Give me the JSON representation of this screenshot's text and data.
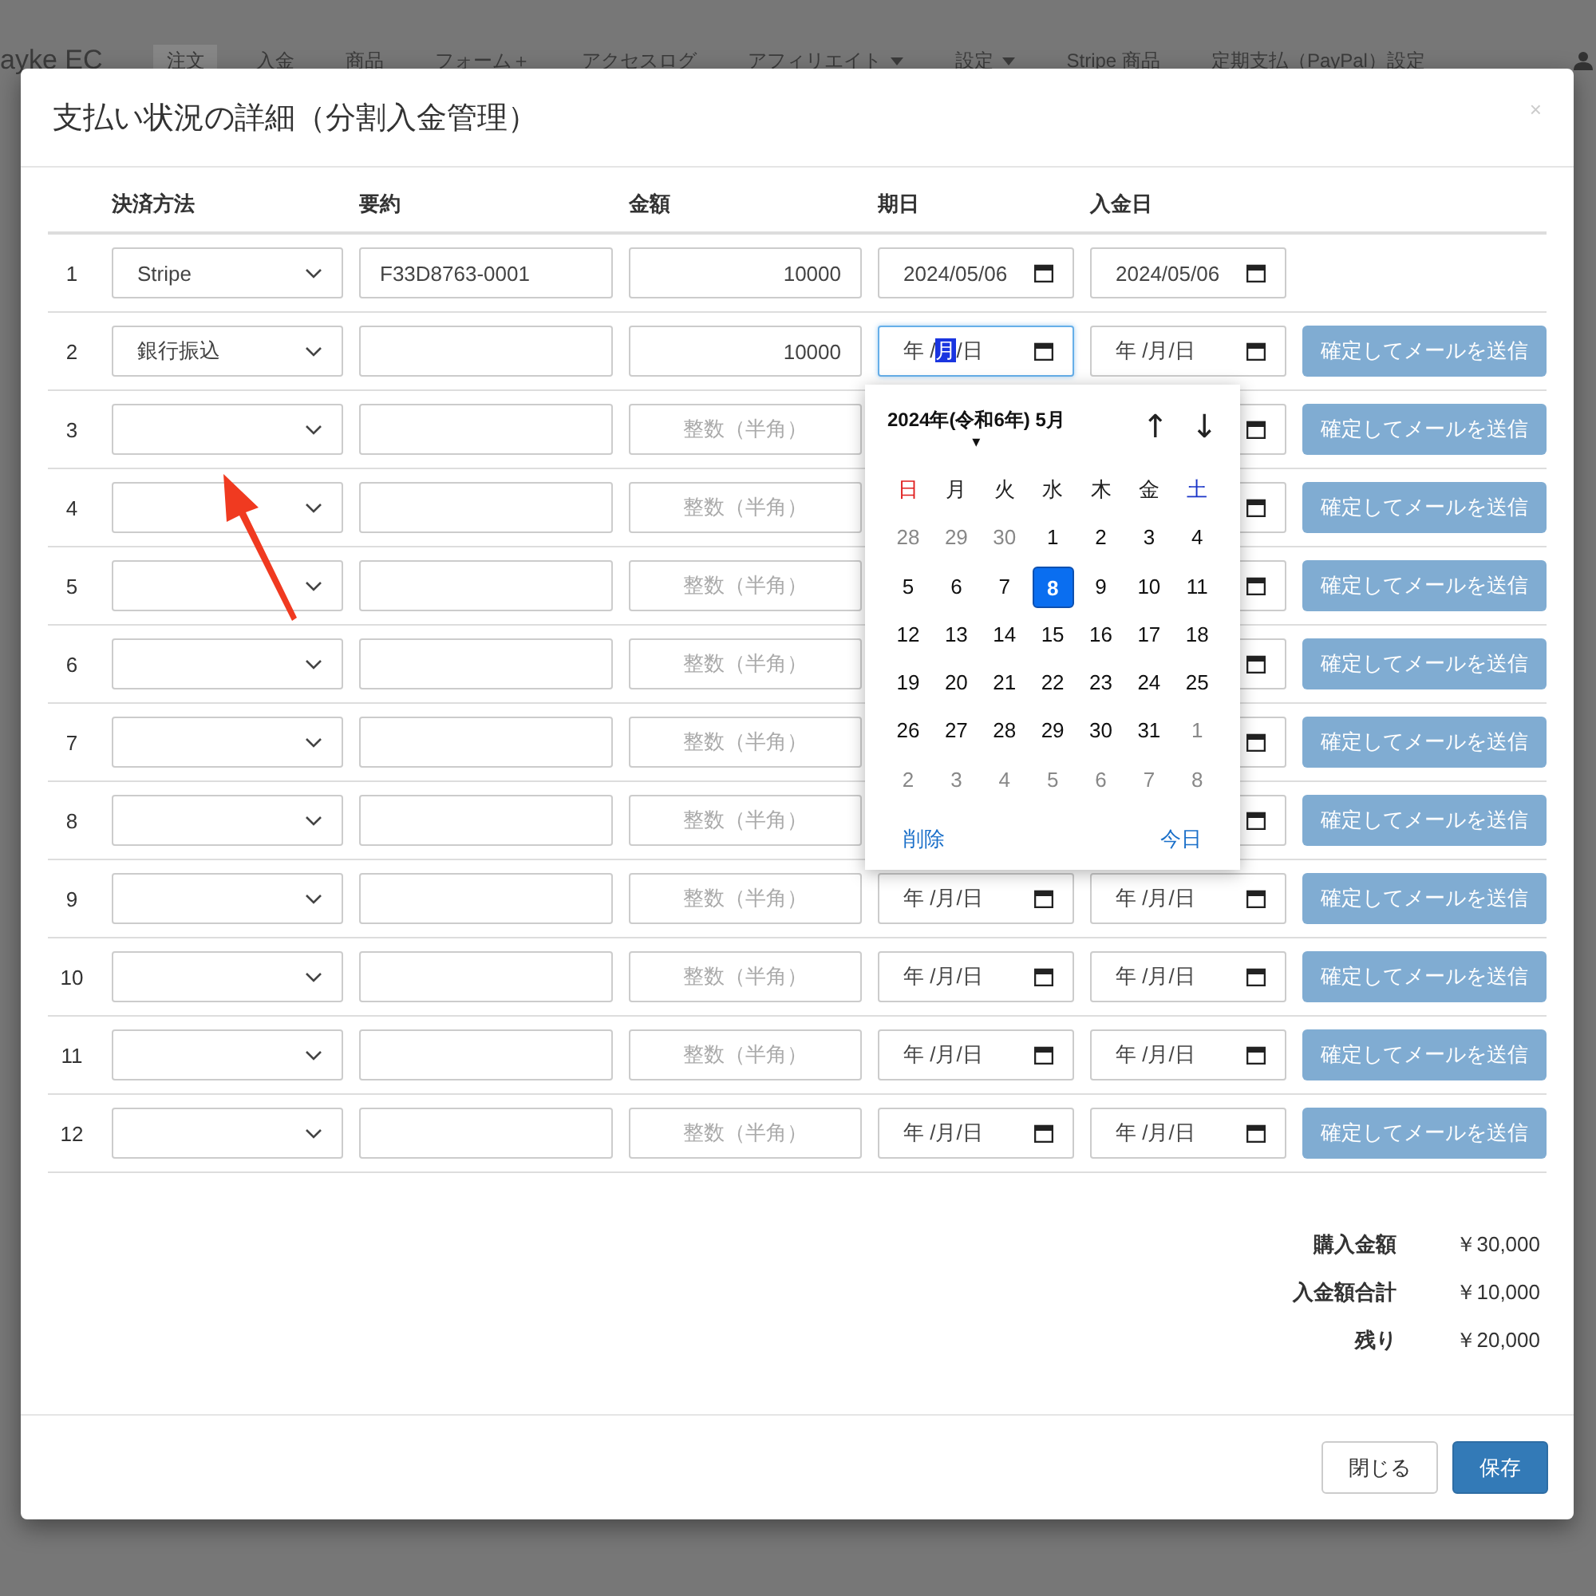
{
  "nav": {
    "brand": "ayke EC",
    "items": [
      {
        "label": "注文",
        "selected": true,
        "dropdown": false
      },
      {
        "label": "入金",
        "selected": false,
        "dropdown": false
      },
      {
        "label": "商品",
        "selected": false,
        "dropdown": false
      },
      {
        "label": "フォーム＋",
        "selected": false,
        "dropdown": false
      },
      {
        "label": "アクセスログ",
        "selected": false,
        "dropdown": false
      },
      {
        "label": "アフィリエイト",
        "selected": false,
        "dropdown": true
      },
      {
        "label": "設定",
        "selected": false,
        "dropdown": true
      },
      {
        "label": "Stripe 商品",
        "selected": false,
        "dropdown": false
      },
      {
        "label": "定期支払（PayPal）設定",
        "selected": false,
        "dropdown": false
      }
    ]
  },
  "modal": {
    "title": "支払い状況の詳細（分割入金管理）",
    "close": "×",
    "columns": [
      "決済方法",
      "要約",
      "金額",
      "期日",
      "入金日"
    ],
    "rows": [
      {
        "number": "1",
        "method": "Stripe",
        "summary": "F33D8763-0001",
        "amount": "10000",
        "due_date": {
          "value": "2024/05/06"
        },
        "paid_date": {
          "value": "2024/05/06"
        }
      },
      {
        "number": "2",
        "method": "銀行振込",
        "amount": "10000",
        "due_date": {
          "focused": true,
          "segments": [
            {
              "text": "年 /",
              "selected": false
            },
            {
              "text": "月",
              "selected": true
            },
            {
              "text": "/日",
              "selected": false
            }
          ]
        },
        "paid_date": {
          "value": "年 /月/日"
        },
        "button": {
          "label": "確定してメールを送信",
          "disabled": true
        }
      },
      {
        "number": "3",
        "placeholder": "整数（半角）",
        "button": {
          "label": "確定してメールを送信",
          "disabled": true
        }
      },
      {
        "number": "4",
        "placeholder": "整数（半角）",
        "button": {
          "label": "確定してメールを送信",
          "disabled": true
        }
      },
      {
        "number": "5",
        "placeholder": "整数（半角）",
        "button": {
          "label": "確定してメールを送信",
          "disabled": true
        }
      },
      {
        "number": "6",
        "placeholder": "整数（半角）",
        "button": {
          "label": "確定してメールを送信",
          "disabled": true
        }
      },
      {
        "number": "7",
        "placeholder": "整数（半角）",
        "button": {
          "label": "確定してメールを送信",
          "disabled": true
        }
      },
      {
        "number": "8",
        "placeholder": "整数（半角）",
        "button": {
          "label": "確定してメールを送信",
          "disabled": true
        }
      },
      {
        "number": "9",
        "placeholder": "整数（半角）",
        "due_date": {
          "value": "年 /月/日"
        },
        "paid_date": {
          "value": "年 /月/日"
        },
        "button": {
          "label": "確定してメールを送信",
          "disabled": true
        }
      },
      {
        "number": "10",
        "placeholder": "整数（半角）",
        "due_date": {
          "value": "年 /月/日"
        },
        "paid_date": {
          "value": "年 /月/日"
        },
        "button": {
          "label": "確定してメールを送信",
          "disabled": true
        }
      },
      {
        "number": "11",
        "placeholder": "整数（半角）",
        "due_date": {
          "value": "年 /月/日"
        },
        "paid_date": {
          "value": "年 /月/日"
        },
        "button": {
          "label": "確定してメールを送信",
          "disabled": true
        }
      },
      {
        "number": "12",
        "placeholder": "整数（半角）",
        "due_date": {
          "value": "年 /月/日"
        },
        "paid_date": {
          "value": "年 /月/日"
        },
        "button": {
          "label": "確定してメールを送信",
          "disabled": true
        }
      }
    ],
    "datepicker": {
      "title": "2024年(令和6年) 5月",
      "caret": "▾",
      "prev": "↑",
      "next": "↓",
      "weekdays": [
        {
          "label": "日",
          "color": "#e01e1e"
        },
        {
          "label": "月",
          "color": "#222222"
        },
        {
          "label": "火",
          "color": "#222222"
        },
        {
          "label": "水",
          "color": "#222222"
        },
        {
          "label": "木",
          "color": "#222222"
        },
        {
          "label": "金",
          "color": "#222222"
        },
        {
          "label": "土",
          "color": "#1a35c8"
        }
      ],
      "weeks": [
        [
          {
            "label": "28",
            "muted": true,
            "selected": false
          },
          {
            "label": "29",
            "muted": true,
            "selected": false
          },
          {
            "label": "30",
            "muted": true,
            "selected": false
          },
          {
            "label": "1",
            "muted": false,
            "selected": false
          },
          {
            "label": "2",
            "muted": false,
            "selected": false
          },
          {
            "label": "3",
            "muted": false,
            "selected": false
          },
          {
            "label": "4",
            "muted": false,
            "selected": false
          }
        ],
        [
          {
            "label": "5",
            "muted": false,
            "selected": false
          },
          {
            "label": "6",
            "muted": false,
            "selected": false
          },
          {
            "label": "7",
            "muted": false,
            "selected": false
          },
          {
            "label": "8",
            "muted": false,
            "selected": true
          },
          {
            "label": "9",
            "muted": false,
            "selected": false
          },
          {
            "label": "10",
            "muted": false,
            "selected": false
          },
          {
            "label": "11",
            "muted": false,
            "selected": false
          }
        ],
        [
          {
            "label": "12",
            "muted": false,
            "selected": false
          },
          {
            "label": "13",
            "muted": false,
            "selected": false
          },
          {
            "label": "14",
            "muted": false,
            "selected": false
          },
          {
            "label": "15",
            "muted": false,
            "selected": false
          },
          {
            "label": "16",
            "muted": false,
            "selected": false
          },
          {
            "label": "17",
            "muted": false,
            "selected": false
          },
          {
            "label": "18",
            "muted": false,
            "selected": false
          }
        ],
        [
          {
            "label": "19",
            "muted": false,
            "selected": false
          },
          {
            "label": "20",
            "muted": false,
            "selected": false
          },
          {
            "label": "21",
            "muted": false,
            "selected": false
          },
          {
            "label": "22",
            "muted": false,
            "selected": false
          },
          {
            "label": "23",
            "muted": false,
            "selected": false
          },
          {
            "label": "24",
            "muted": false,
            "selected": false
          },
          {
            "label": "25",
            "muted": false,
            "selected": false
          }
        ],
        [
          {
            "label": "26",
            "muted": false,
            "selected": false
          },
          {
            "label": "27",
            "muted": false,
            "selected": false
          },
          {
            "label": "28",
            "muted": false,
            "selected": false
          },
          {
            "label": "29",
            "muted": false,
            "selected": false
          },
          {
            "label": "30",
            "muted": false,
            "selected": false
          },
          {
            "label": "31",
            "muted": false,
            "selected": false
          },
          {
            "label": "1",
            "muted": true,
            "selected": false
          }
        ],
        [
          {
            "label": "2",
            "muted": true,
            "selected": false
          },
          {
            "label": "3",
            "muted": true,
            "selected": false
          },
          {
            "label": "4",
            "muted": true,
            "selected": false
          },
          {
            "label": "5",
            "muted": true,
            "selected": false
          },
          {
            "label": "6",
            "muted": true,
            "selected": false
          },
          {
            "label": "7",
            "muted": true,
            "selected": false
          },
          {
            "label": "8",
            "muted": true,
            "selected": false
          }
        ]
      ],
      "clear": "削除",
      "today": "今日"
    },
    "totals": [
      {
        "label": "購入金額",
        "value": "￥30,000"
      },
      {
        "label": "入金額合計",
        "value": "￥10,000"
      },
      {
        "label": "残り",
        "value": "￥20,000"
      }
    ],
    "buttons": [
      {
        "label": "閉じる",
        "kind": "default"
      },
      {
        "label": "保存",
        "kind": "primary"
      }
    ]
  }
}
